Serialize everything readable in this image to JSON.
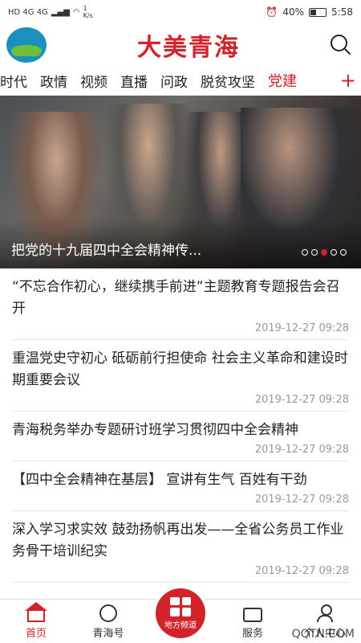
{
  "status_bar": {
    "left": "HD 4G 4G",
    "speed_value": "1",
    "speed_unit": "K/s",
    "alarm_icon": "alarm-icon",
    "battery": "40%",
    "time": "5:58"
  },
  "header": {
    "logo_icon": "qinghai-logo",
    "brand": "大美青海",
    "search_icon": "search-icon"
  },
  "tabs": {
    "items": [
      "时代",
      "政情",
      "视频",
      "直播",
      "问政",
      "脱贫攻坚",
      "党建"
    ],
    "active_index": 6,
    "add_label": "+"
  },
  "banner": {
    "caption": "把党的十九届四中全会精神传...",
    "dots_total": 5,
    "active_dot": 3
  },
  "news": [
    {
      "title": "“不忘合作初心，继续携手前进”主题教育专题报告会召开",
      "time": "2019-12-27 09:28"
    },
    {
      "title": "重温党史守初心 砥砺前行担使命 社会主义革命和建设时期重要会议",
      "time": "2019-12-27 09:28"
    },
    {
      "title": "青海税务举办专题研讨班学习贯彻四中全会精神",
      "time": "2019-12-27 09:28"
    },
    {
      "title": "【四中全会精神在基层】 宣讲有生气 百姓有干劲",
      "time": "2019-12-27 09:28"
    },
    {
      "title": "深入学习求实效 鼓劲扬帆再出发——全省公务员工作业务骨干培训纪实",
      "time": "2019-12-27 09:28"
    }
  ],
  "bottom_nav": {
    "home": "首页",
    "qinghai": "青海号",
    "local": "地方频道",
    "service": "服务",
    "mine": "个人中心"
  },
  "watermark": "QQTN.COM",
  "colors": {
    "accent": "#d2232a"
  }
}
